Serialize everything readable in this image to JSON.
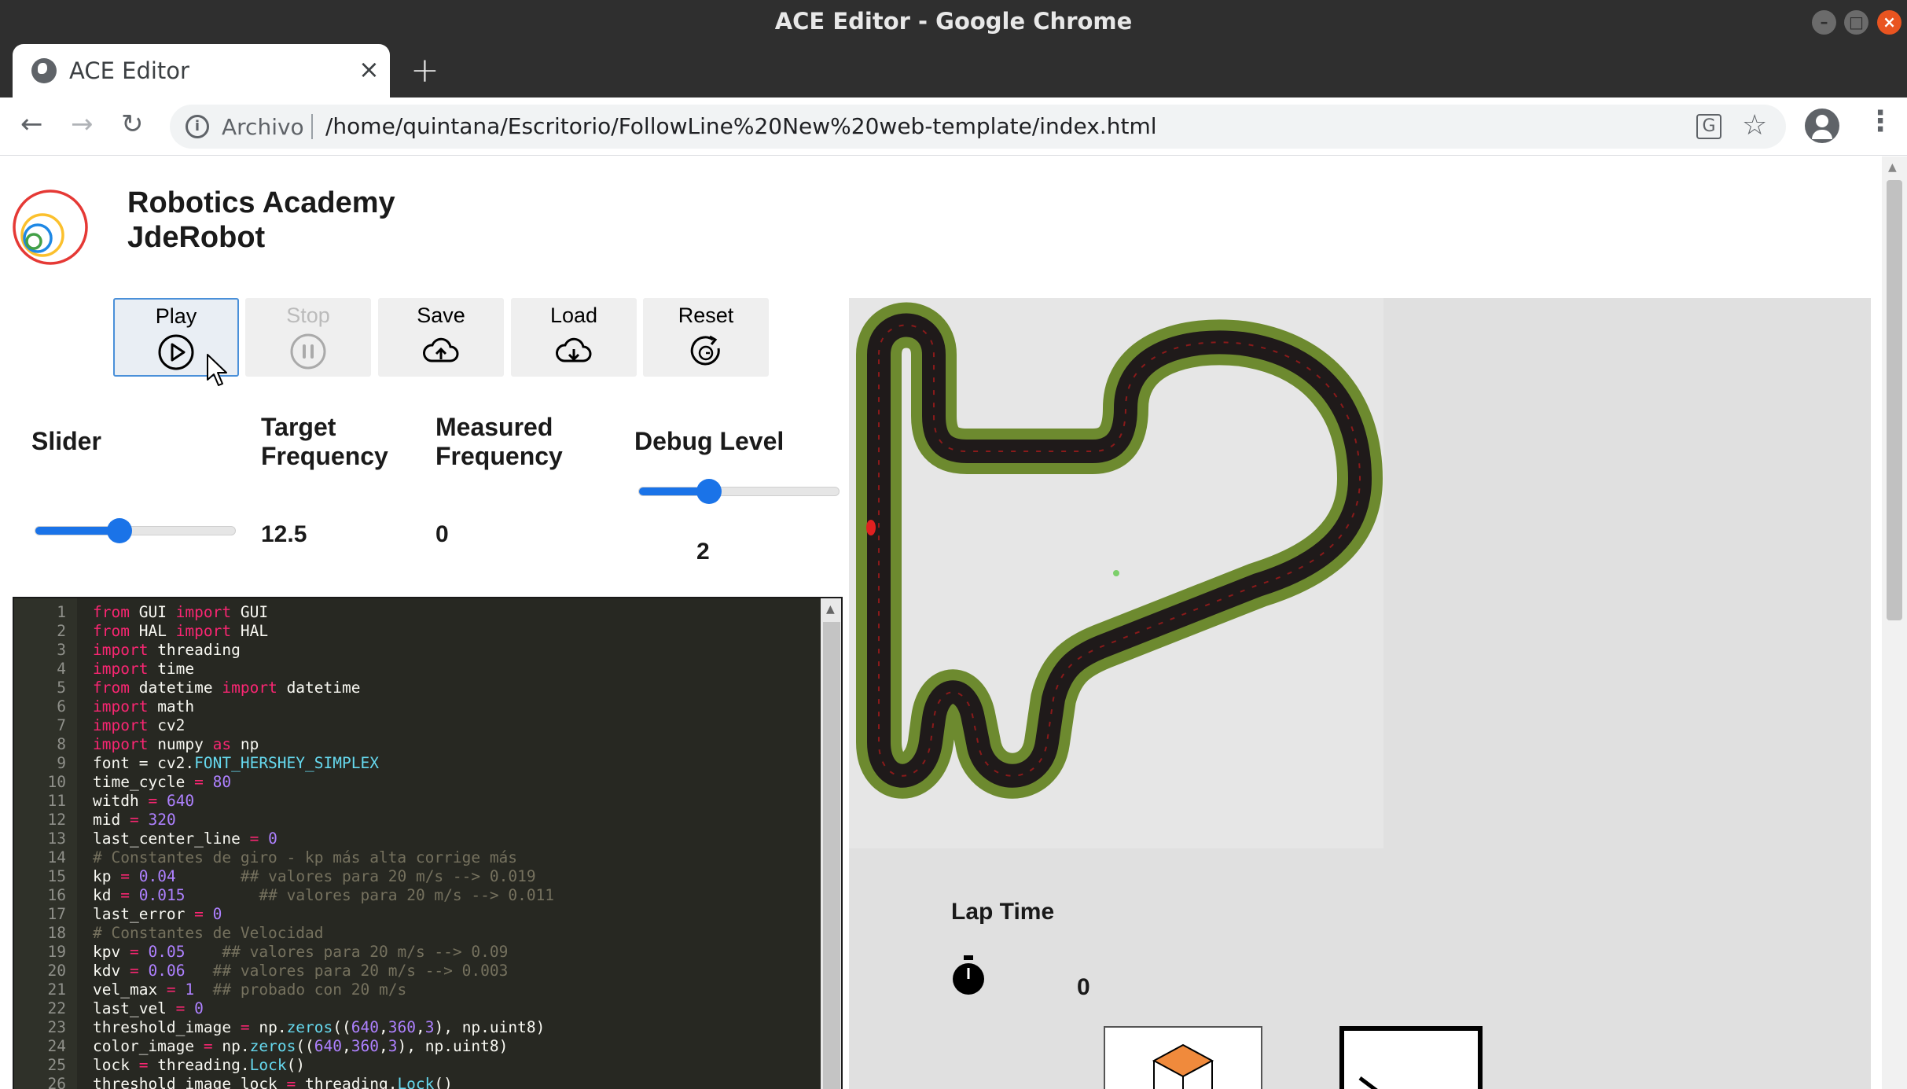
{
  "window": {
    "title": "ACE Editor - Google Chrome"
  },
  "tab": {
    "title": "ACE Editor"
  },
  "address": {
    "origin": "Archivo",
    "url": "/home/quintana/Escritorio/FollowLine%20New%20web-template/index.html"
  },
  "header": {
    "brand_line1": "Robotics Academy",
    "brand_line2": "JdeRobot"
  },
  "controls": {
    "play": "Play",
    "stop": "Stop",
    "save": "Save",
    "load": "Load",
    "reset": "Reset"
  },
  "stats": {
    "slider_label": "Slider",
    "slider_value": 0.42,
    "target_label_1": "Target",
    "target_label_2": "Frequency",
    "target_value": "12.5",
    "measured_label_1": "Measured",
    "measured_label_2": "Frequency",
    "measured_value": "0",
    "debug_label": "Debug Level",
    "debug_value": "2",
    "debug_slider_value": 0.35
  },
  "editor": {
    "lines": [
      [
        [
          "kw",
          "from"
        ],
        [
          "t",
          " GUI "
        ],
        [
          "kw",
          "import"
        ],
        [
          "t",
          " GUI"
        ]
      ],
      [
        [
          "kw",
          "from"
        ],
        [
          "t",
          " HAL "
        ],
        [
          "kw",
          "import"
        ],
        [
          "t",
          " HAL"
        ]
      ],
      [
        [
          "kw",
          "import"
        ],
        [
          "t",
          " threading"
        ]
      ],
      [
        [
          "kw",
          "import"
        ],
        [
          "t",
          " time"
        ]
      ],
      [
        [
          "kw",
          "from"
        ],
        [
          "t",
          " datetime "
        ],
        [
          "kw",
          "import"
        ],
        [
          "t",
          " datetime"
        ]
      ],
      [
        [
          "kw",
          "import"
        ],
        [
          "t",
          " math"
        ]
      ],
      [
        [
          "kw",
          "import"
        ],
        [
          "t",
          " cv2"
        ]
      ],
      [
        [
          "kw",
          "import"
        ],
        [
          "t",
          " numpy "
        ],
        [
          "kw",
          "as"
        ],
        [
          "t",
          " np"
        ]
      ],
      [
        [
          "t",
          "font = cv2."
        ],
        [
          "fn",
          "FONT_HERSHEY_SIMPLEX"
        ]
      ],
      [
        [
          "t",
          "time_cycle "
        ],
        [
          "kw",
          "="
        ],
        [
          "t",
          " "
        ],
        [
          "num",
          "80"
        ]
      ],
      [
        [
          "t",
          "witdh "
        ],
        [
          "kw",
          "="
        ],
        [
          "t",
          " "
        ],
        [
          "num",
          "640"
        ]
      ],
      [
        [
          "t",
          "mid "
        ],
        [
          "kw",
          "="
        ],
        [
          "t",
          " "
        ],
        [
          "num",
          "320"
        ]
      ],
      [
        [
          "t",
          "last_center_line "
        ],
        [
          "kw",
          "="
        ],
        [
          "t",
          " "
        ],
        [
          "num",
          "0"
        ]
      ],
      [
        [
          "cm",
          "# Constantes de giro - kp más alta corrige más"
        ]
      ],
      [
        [
          "t",
          "kp "
        ],
        [
          "kw",
          "="
        ],
        [
          "t",
          " "
        ],
        [
          "num",
          "0.04"
        ],
        [
          "t",
          "       "
        ],
        [
          "cm",
          "## valores para 20 m/s --> 0.019"
        ]
      ],
      [
        [
          "t",
          "kd "
        ],
        [
          "kw",
          "="
        ],
        [
          "t",
          " "
        ],
        [
          "num",
          "0.015"
        ],
        [
          "t",
          "        "
        ],
        [
          "cm",
          "## valores para 20 m/s --> 0.011"
        ]
      ],
      [
        [
          "t",
          "last_error "
        ],
        [
          "kw",
          "="
        ],
        [
          "t",
          " "
        ],
        [
          "num",
          "0"
        ]
      ],
      [
        [
          "cm",
          "# Constantes de Velocidad"
        ]
      ],
      [
        [
          "t",
          "kpv "
        ],
        [
          "kw",
          "="
        ],
        [
          "t",
          " "
        ],
        [
          "num",
          "0.05"
        ],
        [
          "t",
          "    "
        ],
        [
          "cm",
          "## valores para 20 m/s --> 0.09"
        ]
      ],
      [
        [
          "t",
          "kdv "
        ],
        [
          "kw",
          "="
        ],
        [
          "t",
          " "
        ],
        [
          "num",
          "0.06"
        ],
        [
          "t",
          "   "
        ],
        [
          "cm",
          "## valores para 20 m/s --> 0.003"
        ]
      ],
      [
        [
          "t",
          "vel_max "
        ],
        [
          "kw",
          "="
        ],
        [
          "t",
          " "
        ],
        [
          "num",
          "1"
        ],
        [
          "t",
          "  "
        ],
        [
          "cm",
          "## probado con 20 m/s"
        ]
      ],
      [
        [
          "t",
          "last_vel "
        ],
        [
          "kw",
          "="
        ],
        [
          "t",
          " "
        ],
        [
          "num",
          "0"
        ]
      ],
      [
        [
          "t",
          "threshold_image "
        ],
        [
          "kw",
          "="
        ],
        [
          "t",
          " np."
        ],
        [
          "fn",
          "zeros"
        ],
        [
          "t",
          "(("
        ],
        [
          "num",
          "640"
        ],
        [
          "t",
          ","
        ],
        [
          "num",
          "360"
        ],
        [
          "t",
          ","
        ],
        [
          "num",
          "3"
        ],
        [
          "t",
          "), np.uint8)"
        ]
      ],
      [
        [
          "t",
          "color_image "
        ],
        [
          "kw",
          "="
        ],
        [
          "t",
          " np."
        ],
        [
          "fn",
          "zeros"
        ],
        [
          "t",
          "(("
        ],
        [
          "num",
          "640"
        ],
        [
          "t",
          ","
        ],
        [
          "num",
          "360"
        ],
        [
          "t",
          ","
        ],
        [
          "num",
          "3"
        ],
        [
          "t",
          "), np.uint8)"
        ]
      ],
      [
        [
          "t",
          "lock "
        ],
        [
          "kw",
          "="
        ],
        [
          "t",
          " threading."
        ],
        [
          "fn",
          "Lock"
        ],
        [
          "t",
          "()"
        ]
      ],
      [
        [
          "t",
          "threshold_image_lock "
        ],
        [
          "kw",
          "="
        ],
        [
          "t",
          " threading."
        ],
        [
          "fn",
          "Lock"
        ],
        [
          "t",
          "()"
        ]
      ]
    ]
  },
  "lap": {
    "title": "Lap Time",
    "value": "0"
  },
  "icons": {
    "play": "play-circle-icon",
    "stop": "pause-circle-icon",
    "save": "cloud-upload-icon",
    "load": "cloud-download-icon",
    "reset": "reset-icon",
    "timer": "stopwatch-icon"
  },
  "colors": {
    "track_grass": "#6d8a2f",
    "track_road": "#1f1a1a",
    "accent": "#1a73e8",
    "editor_bg": "#272822"
  }
}
